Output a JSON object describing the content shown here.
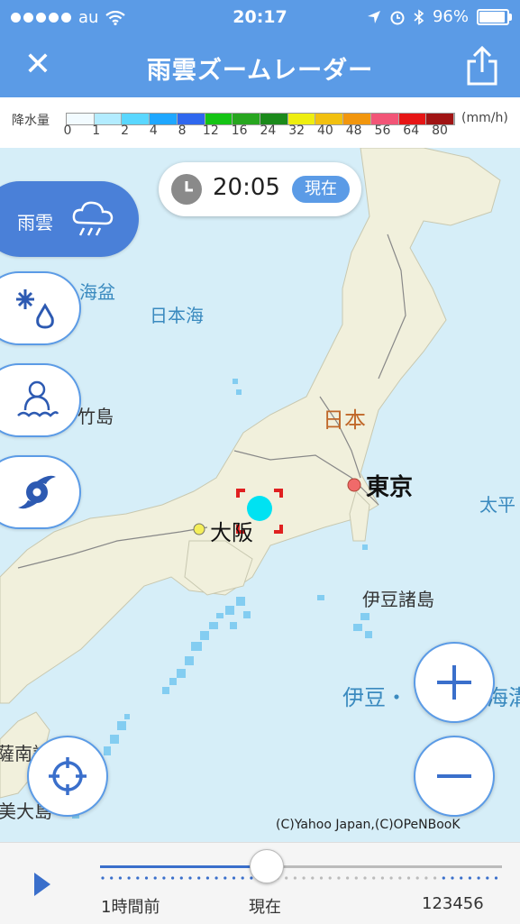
{
  "status_bar": {
    "carrier": "au",
    "time": "20:17",
    "battery": "96%"
  },
  "nav": {
    "title": "雨雲ズームレーダー",
    "close_label": "✕"
  },
  "legend": {
    "label": "降水量",
    "unit": "(mm/h)",
    "ticks": [
      "0",
      "1",
      "2",
      "4",
      "8",
      "12",
      "16",
      "24",
      "32",
      "40",
      "48",
      "56",
      "64",
      "80"
    ],
    "colors": [
      "#f2fbff",
      "#b3ecff",
      "#5ad7ff",
      "#1fa7ff",
      "#2f67ee",
      "#15c415",
      "#27a61f",
      "#1b8a1b",
      "#eeee10",
      "#f2c00f",
      "#f2960d",
      "#f25577",
      "#e61515",
      "#a01414"
    ]
  },
  "map": {
    "labels": {
      "nihonkai_bon": "海盆",
      "nihonkai": "日本海",
      "takeshima": "竹島",
      "nihon": "日本",
      "tokyo": "東京",
      "osaka": "大阪",
      "taihei": "太平",
      "izu_shoto": "伊豆諸島",
      "izu": "伊豆・",
      "kaiko": "海溝",
      "nansei": "薩南諸",
      "amami": "美大島"
    },
    "time": "20:05",
    "now_badge": "現在",
    "copyright": "(C)Yahoo Japan,(C)OPeNBooK",
    "accent_color": "#5b9be6"
  },
  "modes": [
    {
      "label": "雨雲",
      "icon": "rain-cloud-icon",
      "active": true
    },
    {
      "label": "",
      "icon": "snow-rain-icon",
      "active": false
    },
    {
      "label": "",
      "icon": "snowman-icon",
      "active": false
    },
    {
      "label": "",
      "icon": "typhoon-icon",
      "active": false
    }
  ],
  "timeline": {
    "labels": {
      "past": "1時間前",
      "now": "現在",
      "future": "123456"
    },
    "progress": 0.41
  }
}
